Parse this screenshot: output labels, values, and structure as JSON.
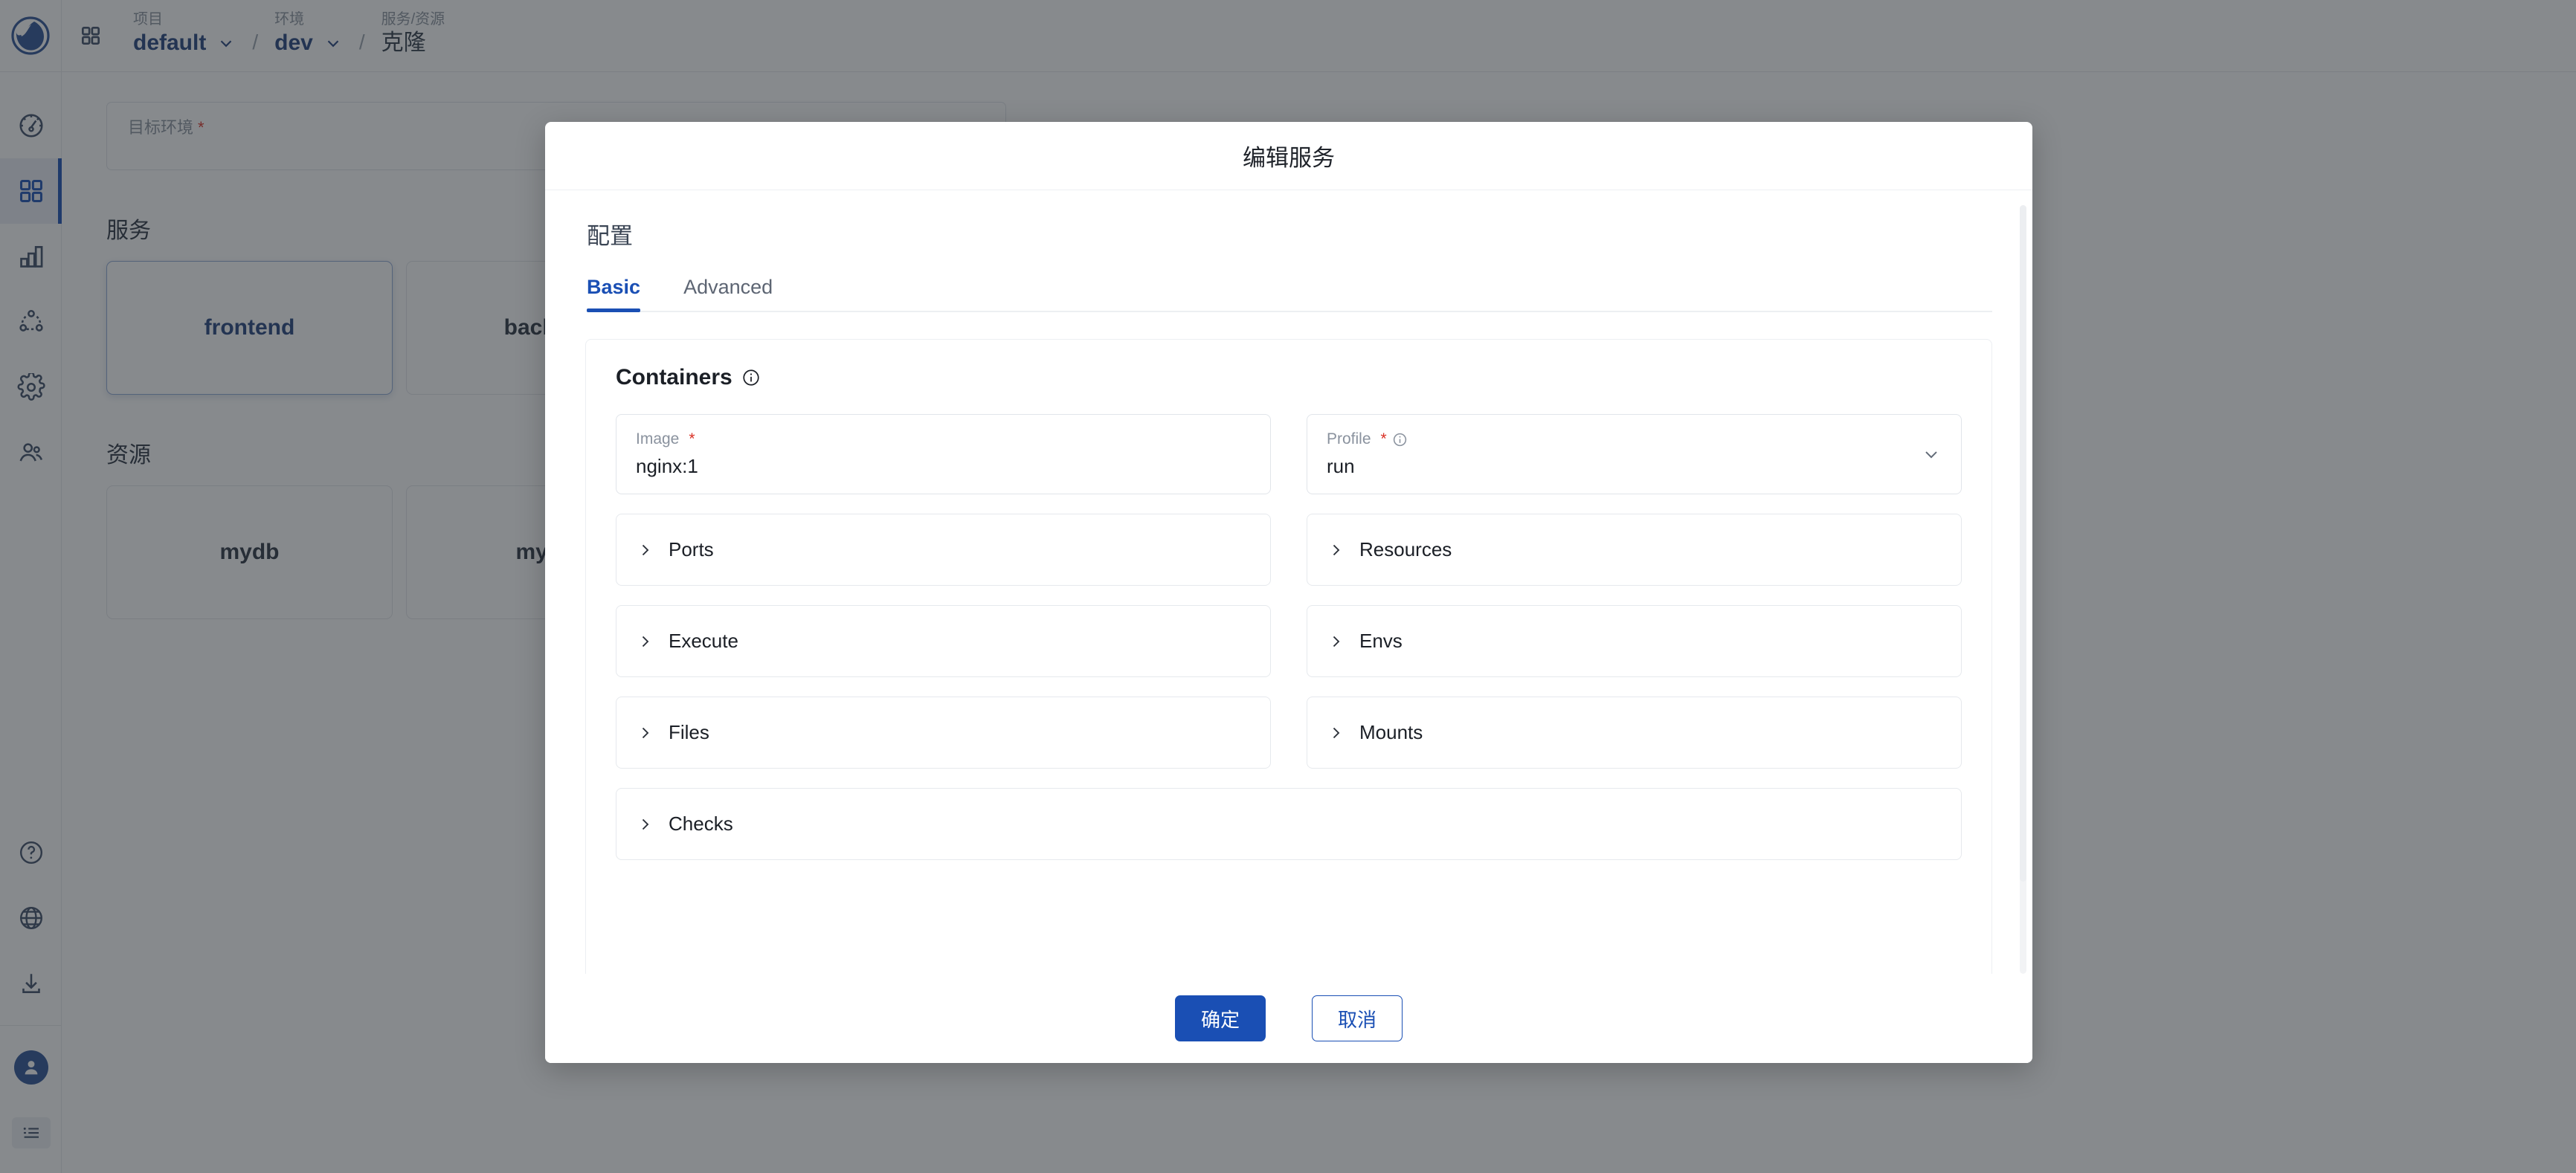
{
  "header": {
    "logo_icon": "logo-icon",
    "grid_icon": "grid-apps-icon",
    "breadcrumbs": [
      {
        "label": "项目",
        "value": "default",
        "has_chevron": true
      },
      {
        "label": "环境",
        "value": "dev",
        "has_chevron": true
      },
      {
        "label": "服务/资源",
        "value": "克隆",
        "has_chevron": false
      }
    ],
    "separator": "/"
  },
  "sidebar": {
    "top_items": [
      {
        "name": "dashboard",
        "icon": "gauge-icon",
        "active": false
      },
      {
        "name": "applications",
        "icon": "grid-icon",
        "active": true
      },
      {
        "name": "metrics",
        "icon": "bar-chart-icon",
        "active": false
      },
      {
        "name": "topology",
        "icon": "network-icon",
        "active": false
      },
      {
        "name": "settings",
        "icon": "gear-icon",
        "active": false
      },
      {
        "name": "members",
        "icon": "users-icon",
        "active": false
      }
    ],
    "bottom_items": [
      {
        "name": "help",
        "icon": "question-circle-icon"
      },
      {
        "name": "language",
        "icon": "globe-icon"
      },
      {
        "name": "download",
        "icon": "download-icon"
      },
      {
        "name": "account",
        "icon": "avatar-icon"
      },
      {
        "name": "logs",
        "icon": "list-icon"
      }
    ]
  },
  "page": {
    "target_env_label": "目标环境",
    "required_mark": "*",
    "services_title": "服务",
    "services": [
      {
        "name": "frontend",
        "selected": true
      },
      {
        "name": "backend",
        "selected": false
      }
    ],
    "resources_title": "资源",
    "resources": [
      {
        "name": "mydb",
        "selected": false
      },
      {
        "name": "my-db",
        "selected": false
      }
    ]
  },
  "modal": {
    "title": "编辑服务",
    "config_heading": "配置",
    "tabs": [
      {
        "label": "Basic",
        "active": true
      },
      {
        "label": "Advanced",
        "active": false
      }
    ],
    "panel": {
      "heading": "Containers",
      "heading_info_icon": "info-icon",
      "fields": [
        {
          "label": "Image",
          "required": "*",
          "value": "nginx:1",
          "has_info": false,
          "has_caret": false
        },
        {
          "label": "Profile",
          "required": "*",
          "value": "run",
          "has_info": true,
          "has_caret": true
        }
      ],
      "accordions": [
        {
          "label": "Ports",
          "column": "left"
        },
        {
          "label": "Resources",
          "column": "right"
        },
        {
          "label": "Execute",
          "column": "left"
        },
        {
          "label": "Envs",
          "column": "right"
        },
        {
          "label": "Files",
          "column": "left"
        },
        {
          "label": "Mounts",
          "column": "right"
        },
        {
          "label": "Checks",
          "column": "full"
        }
      ]
    },
    "footer": {
      "confirm_label": "确定",
      "cancel_label": "取消"
    }
  },
  "colors": {
    "accent": "#1a4fb4",
    "brand_logo": "#2b5196",
    "required": "#d93025",
    "overlay": "rgba(37,41,48,0.55)",
    "text_primary": "#1b1f26",
    "text_muted": "#8a929e"
  }
}
